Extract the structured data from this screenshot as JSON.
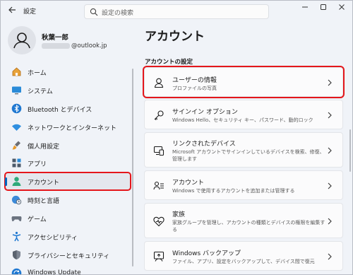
{
  "window": {
    "title": "設定",
    "search_placeholder": "設定の検索"
  },
  "user": {
    "name": "秋葉一郎",
    "email_suffix": "@outlook.jp"
  },
  "sidebar": {
    "items": [
      {
        "label": "ホーム",
        "icon": "home-icon"
      },
      {
        "label": "システム",
        "icon": "monitor-icon"
      },
      {
        "label": "Bluetooth とデバイス",
        "icon": "bluetooth-icon"
      },
      {
        "label": "ネットワークとインターネット",
        "icon": "wifi-icon"
      },
      {
        "label": "個人用設定",
        "icon": "paintbrush-icon"
      },
      {
        "label": "アプリ",
        "icon": "apps-icon"
      },
      {
        "label": "アカウント",
        "icon": "account-icon"
      },
      {
        "label": "時刻と言語",
        "icon": "globe-clock-icon"
      },
      {
        "label": "ゲーム",
        "icon": "gamepad-icon"
      },
      {
        "label": "アクセシビリティ",
        "icon": "accessibility-icon"
      },
      {
        "label": "プライバシーとセキュリティ",
        "icon": "shield-icon"
      },
      {
        "label": "Windows Update",
        "icon": "update-icon"
      }
    ]
  },
  "main": {
    "title": "アカウント",
    "section_title": "アカウントの設定",
    "cards": [
      {
        "title": "ユーザーの情報",
        "desc": "プロファイルの写真",
        "icon": "user-outline-icon"
      },
      {
        "title": "サインイン オプション",
        "desc": "Windows Hello、セキュリティ キー、パスワード、動的ロック",
        "icon": "key-icon"
      },
      {
        "title": "リンクされたデバイス",
        "desc": "Microsoft アカウントでサインインしているデバイスを検索、修復、管理します",
        "icon": "devices-icon"
      },
      {
        "title": "アカウント",
        "desc": "Windows で使用するアカウントを追加または管理する",
        "icon": "account-list-icon"
      },
      {
        "title": "家族",
        "desc": "家族グループを管理し、アカウントの種類とデバイスの権限を編集する",
        "icon": "family-heart-icon"
      },
      {
        "title": "Windows バックアップ",
        "desc": "ファイル、アプリ、設定をバックアップして、デバイス間で復元",
        "icon": "backup-icon"
      }
    ]
  },
  "colors": {
    "accent": "#0067c0",
    "highlight_border": "#e4161b"
  }
}
